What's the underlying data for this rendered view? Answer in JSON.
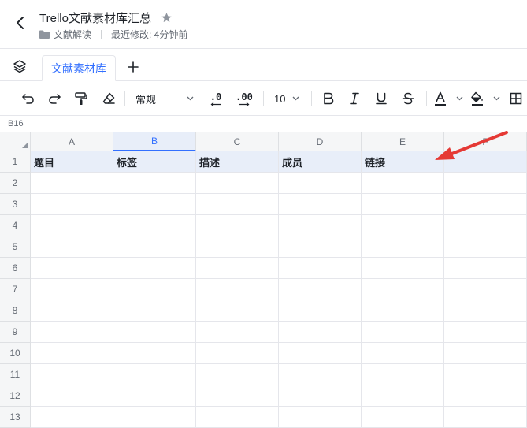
{
  "header": {
    "title": "Trello文献素材库汇总",
    "folder": "文献解读",
    "last_modified": "最近修改: 4分钟前",
    "star_color": "#8f959e"
  },
  "tabs": [
    {
      "label": "文献素材库",
      "active": true
    }
  ],
  "toolbar": {
    "font_style": "常规",
    "font_size": "10",
    "decimal_decrease": ".0",
    "decimal_increase": ".00",
    "text_color": "#1f2329",
    "fill_color": "#1f2329"
  },
  "cell_ref": "B16",
  "grid": {
    "columns": [
      "A",
      "B",
      "C",
      "D",
      "E",
      "F"
    ],
    "selected_column": "B",
    "row_numbers": [
      "1",
      "2",
      "3",
      "4",
      "5",
      "6",
      "7",
      "8",
      "9",
      "10",
      "11",
      "12",
      "13"
    ],
    "header_row": [
      "题目",
      "标签",
      "描述",
      "成员",
      "链接",
      ""
    ],
    "header_fill": "#e8eef9"
  },
  "annotation": {
    "arrow_color": "#e53935"
  }
}
